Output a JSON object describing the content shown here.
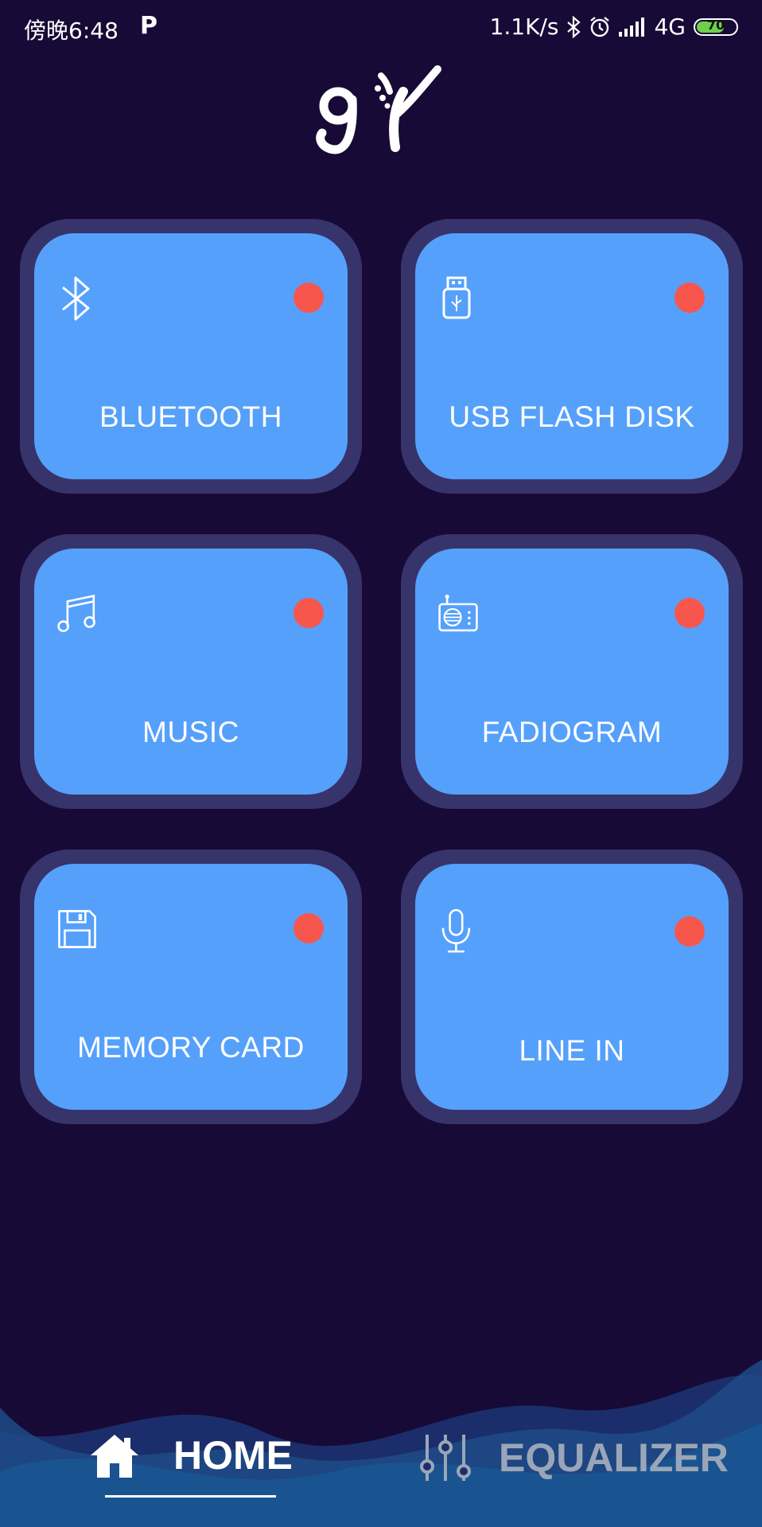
{
  "status_bar": {
    "time": "傍晚6:48",
    "p_icon": "P",
    "network_speed": "1.1K/s",
    "network_type": "4G",
    "battery": "70",
    "battery_level": 0.7
  },
  "logo_text": "gY",
  "cards": [
    {
      "label": "BLUETOOTH",
      "icon": "bluetooth-icon"
    },
    {
      "label": "USB FLASH DISK",
      "icon": "usb-icon"
    },
    {
      "label": "MUSIC",
      "icon": "music-note-icon"
    },
    {
      "label": "FADIOGRAM",
      "icon": "radio-icon"
    },
    {
      "label": "MEMORY CARD",
      "icon": "floppy-disk-icon"
    },
    {
      "label": "LINE IN",
      "icon": "microphone-icon"
    }
  ],
  "nav": {
    "home": "HOME",
    "equalizer": "EQUALIZER",
    "active": "home"
  },
  "colors": {
    "background": "#170a36",
    "card": "#55a0fb",
    "card_border": "#37346b",
    "indicator": "#f7564d"
  }
}
